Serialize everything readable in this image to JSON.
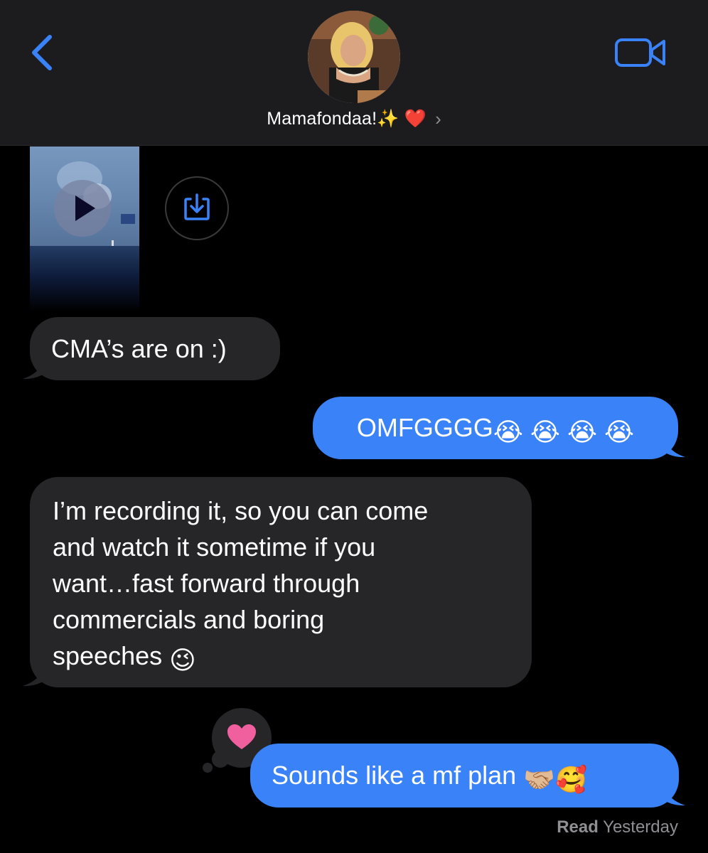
{
  "header": {
    "contact_name": "Mamafondaa!✨ ❤️",
    "chevron": "›",
    "back_icon": "chevron-left-icon",
    "video_icon": "video-camera-icon",
    "accent": "#3a82f7"
  },
  "messages": [
    {
      "from": "them",
      "type": "video"
    },
    {
      "from": "them",
      "text": "CMA’s are on :)"
    },
    {
      "from": "me",
      "text": "OMFGGGG",
      "emoji": "😭 😭 😭 😭"
    },
    {
      "from": "them",
      "lines": [
        "I’m recording it, so you can come",
        "and watch it sometime if you",
        "want…fast forward through",
        "commercials and boring",
        "speeches"
      ],
      "emoji": "😉"
    },
    {
      "from": "me",
      "text": "Sounds like a mf plan",
      "emoji": "🤝🏼🥰",
      "tapback": "❤"
    }
  ],
  "receipt": {
    "status": "Read",
    "time": "Yesterday"
  },
  "colors": {
    "incoming_bubble": "#262629",
    "outgoing_bubble": "#3a82f7",
    "background": "#000000",
    "header_bg": "#1c1c1e"
  }
}
